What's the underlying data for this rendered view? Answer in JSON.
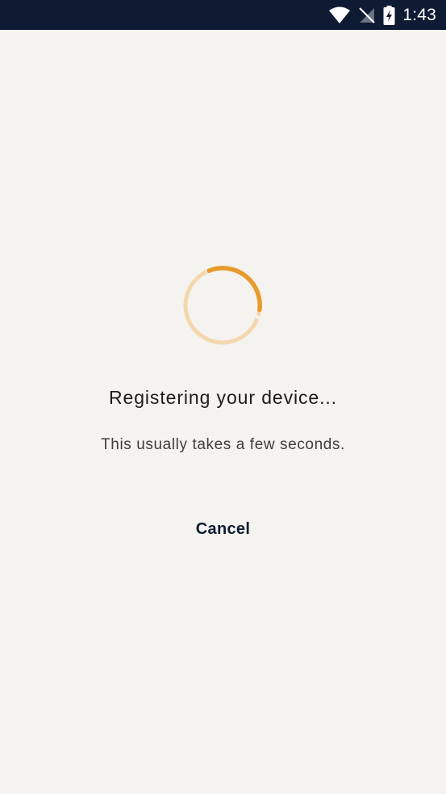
{
  "status_bar": {
    "time": "1:43",
    "icons": [
      "wifi-icon",
      "no-signal-icon",
      "battery-charging-icon"
    ]
  },
  "loading": {
    "spinner_icon": "loading-spinner-icon",
    "accent_color": "#e89a2c",
    "track_color": "#f3d7ad"
  },
  "main": {
    "title": "Registering your device...",
    "subtitle": "This usually takes a few seconds.",
    "cancel_label": "Cancel"
  }
}
